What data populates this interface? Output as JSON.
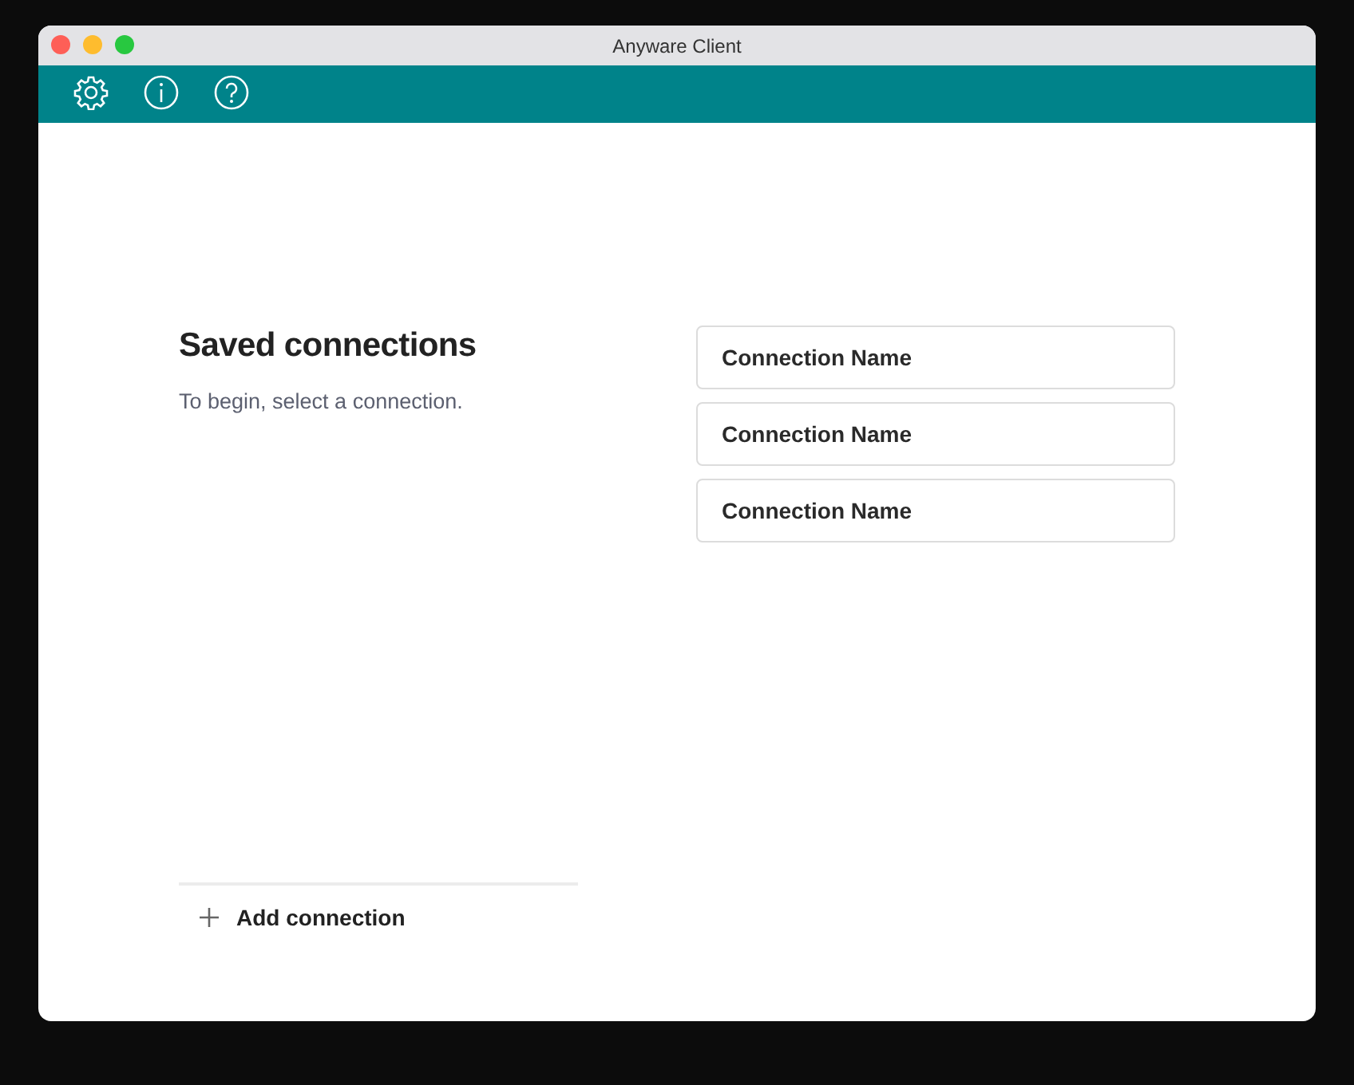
{
  "window": {
    "title": "Anyware Client"
  },
  "toolbar": {
    "buttons": [
      {
        "kind": "settings"
      },
      {
        "kind": "info"
      },
      {
        "kind": "help"
      }
    ]
  },
  "heading": "Saved connections",
  "subtitle": "To begin, select a connection.",
  "connections": [
    {
      "name": "Connection Name"
    },
    {
      "name": "Connection Name"
    },
    {
      "name": "Connection Name"
    }
  ],
  "add_button": {
    "label": "Add connection"
  }
}
